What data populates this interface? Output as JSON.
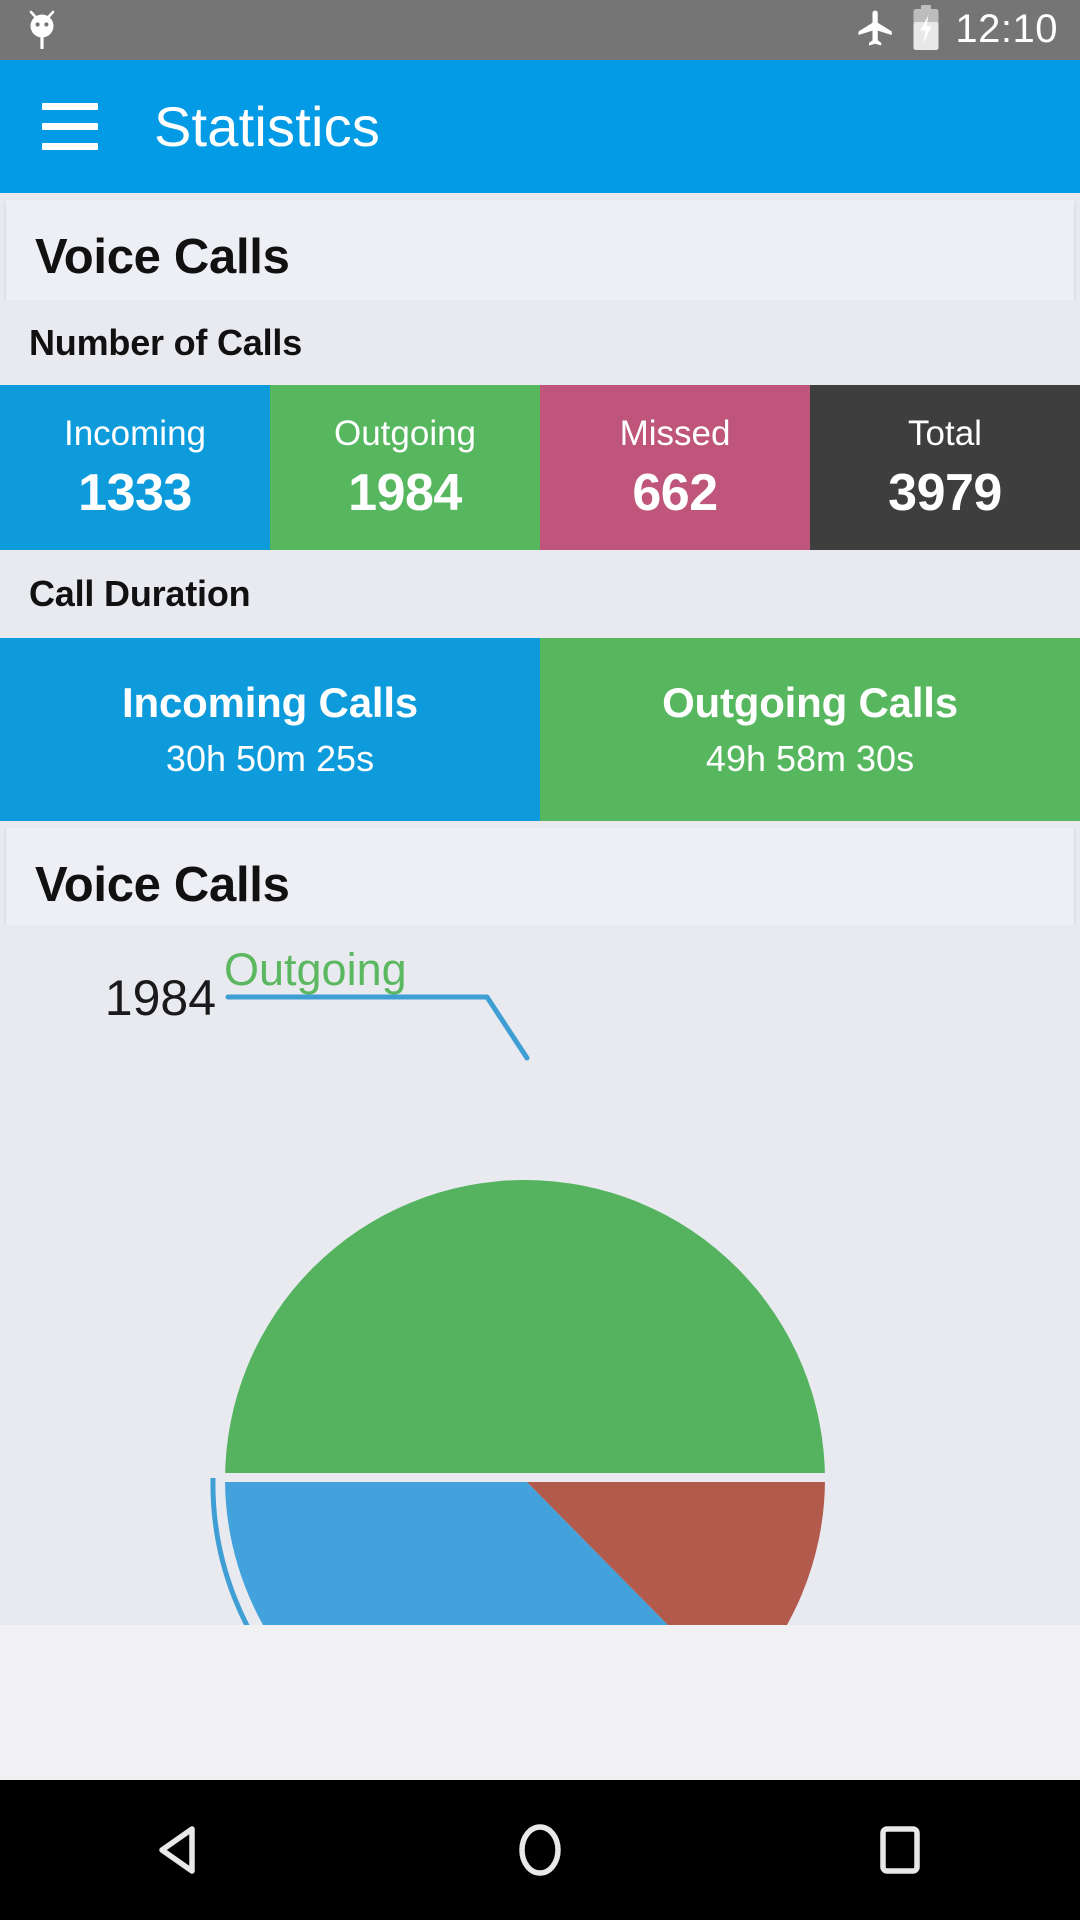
{
  "status_bar": {
    "notification_icon": "bug-droid-icon",
    "airplane_icon": "airplane-mode-icon",
    "battery_icon": "battery-charging-icon",
    "time": "12:10",
    "background_color": "#757575"
  },
  "app_bar": {
    "menu_icon": "hamburger-menu-icon",
    "title": "Statistics",
    "background_color": "#039BE5"
  },
  "sections": {
    "voice_calls_header_1": "Voice Calls",
    "number_of_calls_label": "Number of Calls",
    "call_duration_label": "Call Duration",
    "voice_calls_header_2": "Voice Calls"
  },
  "counts": [
    {
      "label": "Incoming",
      "value": "1333",
      "color": "#0D9BDC"
    },
    {
      "label": "Outgoing",
      "value": "1984",
      "color": "#57B75F"
    },
    {
      "label": "Missed",
      "value": "662",
      "color": "#BF557B"
    },
    {
      "label": "Total",
      "value": "3979",
      "color": "#3E3E3E"
    }
  ],
  "durations": [
    {
      "title": "Incoming Calls",
      "value": "30h 50m 25s",
      "color": "#0D9BDC"
    },
    {
      "title": "Outgoing Calls",
      "value": "49h 58m 30s",
      "color": "#57B75F"
    }
  ],
  "chart_data": {
    "type": "pie",
    "title": "Voice Calls",
    "categories": [
      "Outgoing",
      "Incoming",
      "Missed"
    ],
    "values": [
      1984,
      1333,
      662
    ],
    "colors": [
      "#55B35F",
      "#43A2DC",
      "#B25A4C"
    ],
    "total": 3979,
    "legend": "none",
    "annotations": [
      {
        "label": "Outgoing",
        "value": "1984",
        "label_color": "#5CB860",
        "value_color": "#1A1A1A",
        "leader_line_color": "#3F9FD4"
      }
    ],
    "note": "Pie is clipped by the scroll viewport; only the top portion is visible."
  },
  "nav_bar": {
    "back_icon": "back-triangle-icon",
    "home_icon": "home-circle-icon",
    "recents_icon": "recents-square-icon",
    "background_color": "#000000"
  }
}
